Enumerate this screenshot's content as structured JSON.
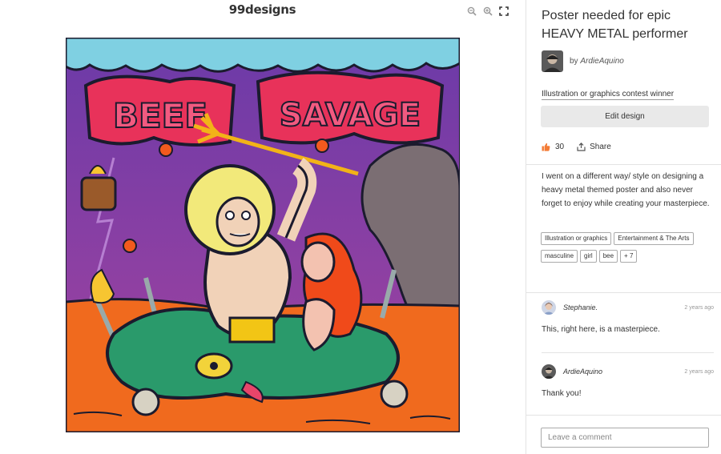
{
  "viewer": {
    "brand": "99designs",
    "tools": [
      "zoom-out-icon",
      "zoom-in-icon",
      "fullscreen-icon"
    ],
    "artwork_lettering": "BEEF SAVAGE"
  },
  "panel": {
    "title": "Poster needed for epic HEAVY METAL performer",
    "author_prefix": "by",
    "author": "ArdieAquino",
    "winner_label": "Illustration or graphics contest winner",
    "edit_button": "Edit design",
    "likes": "30",
    "share": "Share",
    "description": "I went on a different way/ style on designing a heavy metal themed poster and also never forget to enjoy while creating your masterpiece.",
    "tags": [
      "Illustration or graphics",
      "Entertainment & The Arts",
      "masculine",
      "girl",
      "bee",
      "+ 7"
    ],
    "comments": [
      {
        "name": "Stephanie.",
        "time": "2 years ago",
        "text": "This, right here, is a masterpiece."
      },
      {
        "name": "ArdieAquino",
        "time": "2 years ago",
        "text": "Thank you!"
      }
    ],
    "comment_placeholder": "Leave a comment"
  },
  "colors": {
    "accent_like": "#f37b35",
    "button_bg": "#e9e9e9",
    "sky_purple": "#8b3fb0",
    "ground_orange": "#f06a1e",
    "title_pink": "#e8325a"
  }
}
